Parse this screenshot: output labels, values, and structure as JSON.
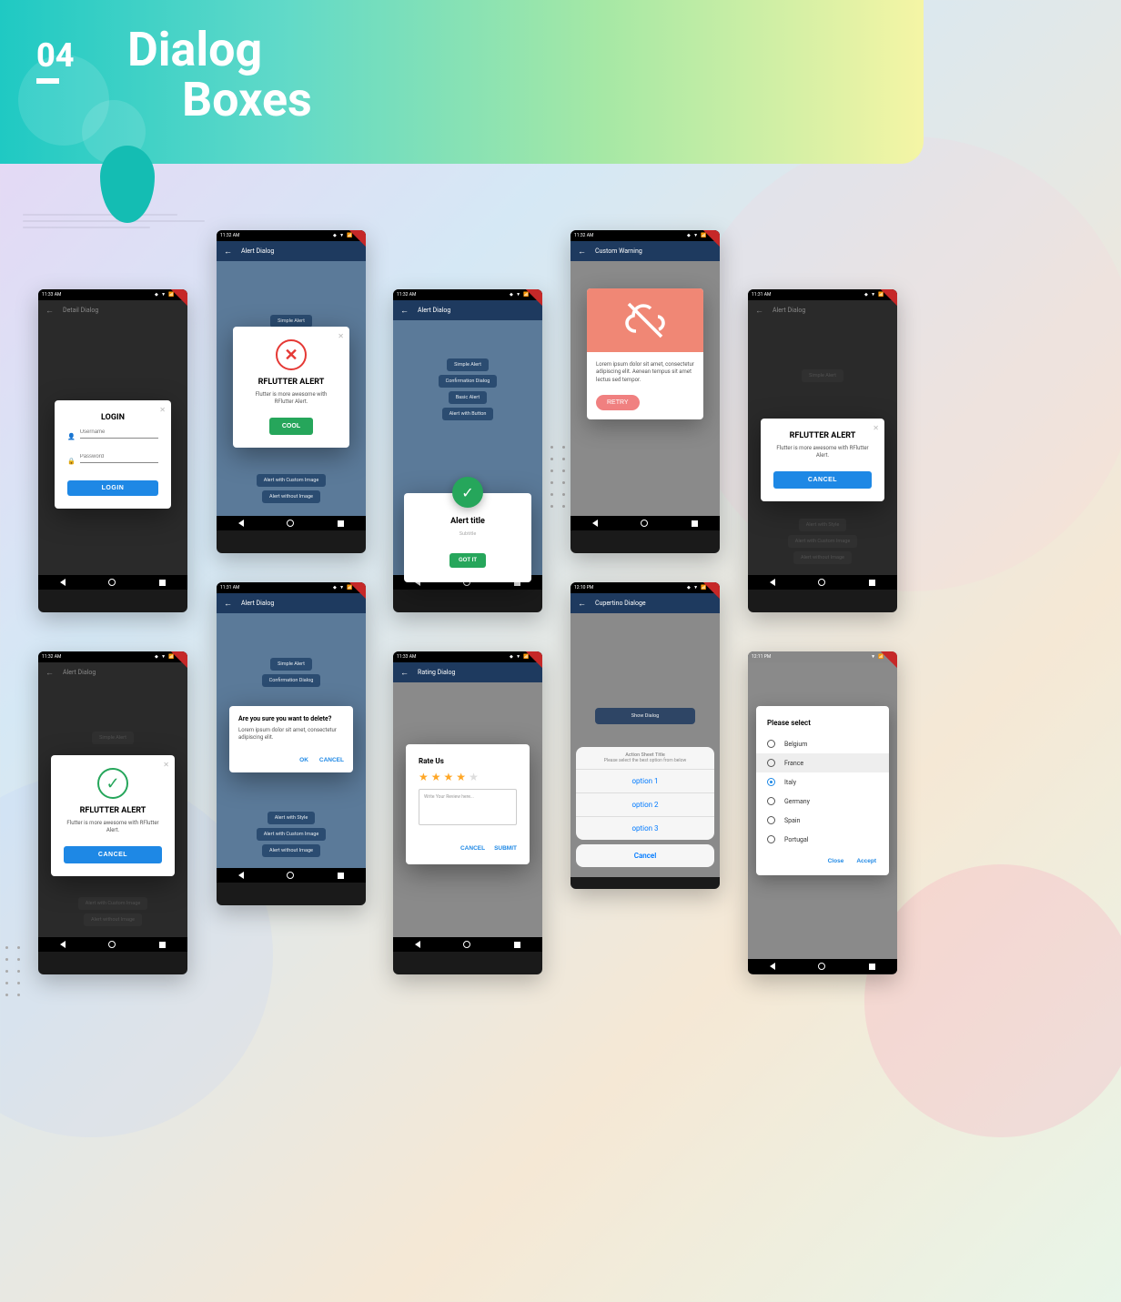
{
  "header": {
    "number": "04",
    "title_line1": "Dialog",
    "title_line2": "Boxes"
  },
  "phone1": {
    "time": "11:33 AM",
    "appbar": "Detail Dialog",
    "dialog": {
      "title": "LOGIN",
      "username_ph": "Username",
      "password_ph": "Password",
      "button": "LOGIN"
    }
  },
  "phone2": {
    "time": "11:32 AM",
    "appbar": "Alert Dialog",
    "bg_buttons": [
      "Simple Alert"
    ],
    "bg_more": [
      "Alert with Custom Image",
      "Alert without Image"
    ],
    "dialog": {
      "title": "RFLUTTER ALERT",
      "body": "Flutter is more awesome with RFlutter Alert.",
      "button": "COOL"
    }
  },
  "phone3": {
    "time": "11:32 AM",
    "appbar": "Alert Dialog",
    "bg_buttons": [
      "Simple Alert",
      "Confirmation Dialog",
      "Basic Alert",
      "Alert with Button"
    ],
    "dialog": {
      "title": "Alert title",
      "subtitle": "Subtitle",
      "button": "GOT IT"
    }
  },
  "phone4": {
    "time": "11:32 AM",
    "appbar": "Custom Warning",
    "card": {
      "body": "Lorem ipsum dolor sit amet, consectetur adipiscing elit. Aenean tempus sit amet lectus sed tempor.",
      "button": "RETRY"
    }
  },
  "phone5": {
    "time": "11:31 AM",
    "appbar": "Alert Dialog",
    "bg_buttons": [
      "Simple Alert",
      "",
      "Alert with Style",
      "Alert with Custom Image",
      "Alert without Image"
    ],
    "dialog": {
      "title": "RFLUTTER ALERT",
      "body": "Flutter is more awesome with RFlutter Alert.",
      "button": "CANCEL"
    }
  },
  "phone6": {
    "time": "11:32 AM",
    "appbar": "Alert Dialog",
    "bg_buttons": [
      "Simple Alert",
      "",
      "",
      "Alert with Custom Image",
      "Alert without Image"
    ],
    "dialog": {
      "title": "RFLUTTER ALERT",
      "body": "Flutter is more awesome with RFlutter Alert.",
      "button": "CANCEL"
    }
  },
  "phone7": {
    "time": "11:31 AM",
    "appbar": "Alert Dialog",
    "bg_buttons": [
      "Simple Alert",
      "Confirmation Dialog",
      "",
      "Alert with Style",
      "Alert with Custom Image",
      "Alert without Image"
    ],
    "dialog": {
      "title": "Are you sure you want to delete?",
      "body": "Lorem ipsum dolor sit amet, consectetur adipiscing elit.",
      "ok": "OK",
      "cancel": "CANCEL"
    }
  },
  "phone8": {
    "time": "11:33 AM",
    "appbar": "Rating Dialog",
    "dialog": {
      "title": "Rate Us",
      "placeholder": "Write Your Review here...",
      "cancel": "CANCEL",
      "submit": "SUBMIT"
    }
  },
  "phone9": {
    "time": "12:10 PM",
    "appbar": "Cupertino Dialoge",
    "show": "Show Dialog",
    "sheet": {
      "title": "Action Sheet Title",
      "subtitle": "Please select the best option from below",
      "options": [
        "option 1",
        "option 2",
        "option 3"
      ],
      "cancel": "Cancel"
    }
  },
  "phone10": {
    "time": "12:11 PM",
    "panel": {
      "title": "Please select",
      "items": [
        "Belgium",
        "France",
        "Italy",
        "Germany",
        "Spain",
        "Portugal"
      ],
      "selected_index": 2,
      "highlighted_index": 1,
      "close": "Close",
      "accept": "Accept"
    }
  }
}
